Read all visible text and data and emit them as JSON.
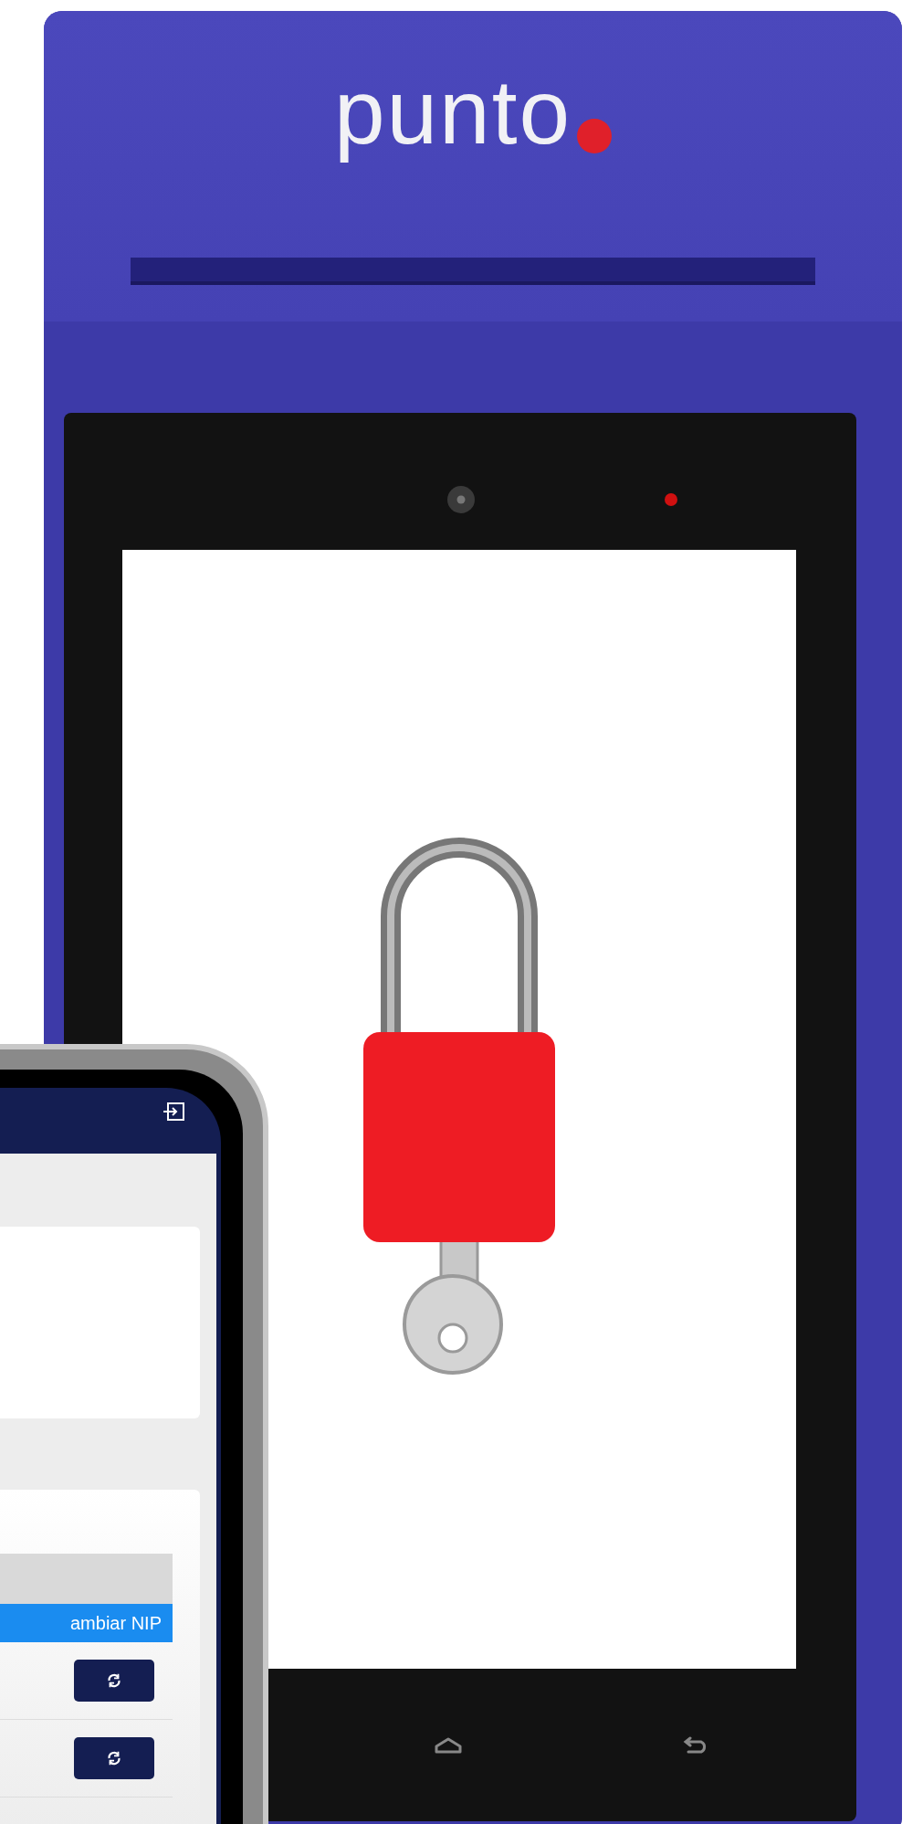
{
  "device": {
    "brand": "punto"
  },
  "phone": {
    "table": {
      "highlight": "ambiar NIP",
      "rows": [
        {
          "kind": "reset"
        },
        {
          "kind": "reset"
        }
      ]
    }
  }
}
